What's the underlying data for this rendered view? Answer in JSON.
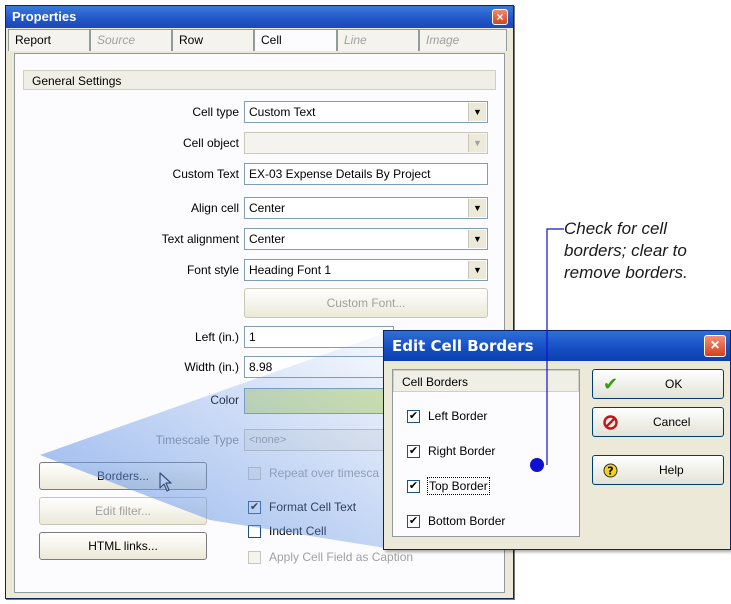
{
  "properties": {
    "title": "Properties",
    "tabs": [
      {
        "label": "Report",
        "enabled": true
      },
      {
        "label": "Source",
        "enabled": false
      },
      {
        "label": "Row",
        "enabled": true
      },
      {
        "label": "Cell",
        "enabled": true
      },
      {
        "label": "Line",
        "enabled": false
      },
      {
        "label": "Image",
        "enabled": false
      }
    ],
    "section_title": "General Settings",
    "fields": {
      "cell_type": {
        "label": "Cell type",
        "value": "Custom Text"
      },
      "cell_object": {
        "label": "Cell object",
        "value": ""
      },
      "custom_text": {
        "label": "Custom Text",
        "value": "EX-03  Expense Details By Project"
      },
      "align_cell": {
        "label": "Align cell",
        "value": "Center"
      },
      "text_alignment": {
        "label": "Text alignment",
        "value": "Center"
      },
      "font_style": {
        "label": "Font style",
        "value": "Heading Font 1"
      },
      "left": {
        "label": "Left (in.)",
        "value": "1"
      },
      "width": {
        "label": "Width (in.)",
        "value": "8.98"
      },
      "color": {
        "label": "Color",
        "value": "",
        "swatch": "#d9e8a4"
      },
      "timescale_type": {
        "label": "Timescale Type",
        "value": "<none>"
      }
    },
    "custom_font_button": "Custom Font...",
    "buttons": {
      "borders": "Borders...",
      "edit_filter": "Edit filter...",
      "html_links": "HTML links..."
    },
    "checks": {
      "repeat_over_timescale": {
        "label": "Repeat over timesca",
        "checked": false,
        "enabled": false
      },
      "format_cell_text": {
        "label": "Format Cell Text",
        "checked": true,
        "enabled": true
      },
      "indent_cell": {
        "label": "Indent Cell",
        "checked": false,
        "enabled": true
      },
      "apply_caption": {
        "label": "Apply Cell Field as Caption",
        "checked": false,
        "enabled": false
      }
    }
  },
  "dialog": {
    "title": "Edit Cell Borders",
    "group_title": "Cell Borders",
    "borders": [
      {
        "label": "Left Border",
        "checked": true
      },
      {
        "label": "Right Border",
        "checked": true
      },
      {
        "label": "Top Border",
        "checked": true
      },
      {
        "label": "Bottom Border",
        "checked": true
      }
    ],
    "buttons": {
      "ok": "OK",
      "cancel": "Cancel",
      "help": "Help"
    }
  },
  "annotation": {
    "text": "Check for cell borders; clear to remove borders."
  },
  "colors": {
    "title_blue": "#2155c8",
    "callout_dot": "#1010d0",
    "beam": "#6e9be6",
    "ok_green": "#3a9a1a",
    "cancel_red": "#c01818",
    "help_yellow": "#f2d21c"
  }
}
